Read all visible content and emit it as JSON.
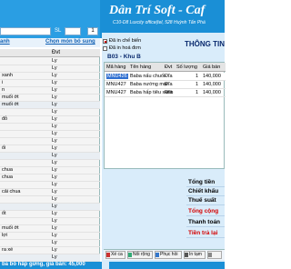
{
  "header": {
    "brand": "Dân Trí Soft - Caf",
    "subtitle": "C10-D8 Luxcity office(tel, 528 Huỳnh Tấn Phá",
    "address": ""
  },
  "order_search": {
    "sl_label": "SL",
    "quantity": "1",
    "search_value": ""
  },
  "links": {
    "left": "anh",
    "right": "Chọn món bổ sung"
  },
  "menu": {
    "col_name": "",
    "col_unit": "Đvt",
    "rows": [
      {
        "name": "",
        "unit": "Ly"
      },
      {
        "name": "",
        "unit": "Ly"
      },
      {
        "name": "xanh",
        "unit": "Ly"
      },
      {
        "name": "i",
        "unit": "Ly"
      },
      {
        "name": "n",
        "unit": "Ly"
      },
      {
        "name": "muối ớt",
        "unit": "Ly"
      },
      {
        "name": "muối ớt",
        "unit": "Ly"
      },
      {
        "name": "",
        "unit": "Ly"
      },
      {
        "name": "đỏ",
        "unit": "Ly"
      },
      {
        "name": "",
        "unit": "Ly"
      },
      {
        "name": "",
        "unit": "Ly"
      },
      {
        "name": "",
        "unit": "Ly"
      },
      {
        "name": "ối",
        "unit": "Ly"
      },
      {
        "name": "",
        "unit": "Ly"
      },
      {
        "name": "",
        "unit": "Ly"
      },
      {
        "name": "chua",
        "unit": "Ly"
      },
      {
        "name": "chua",
        "unit": "Ly"
      },
      {
        "name": "",
        "unit": "Ly"
      },
      {
        "name": "cải chua",
        "unit": "Ly"
      },
      {
        "name": "",
        "unit": "Ly"
      },
      {
        "name": "",
        "unit": "Ly"
      },
      {
        "name": "ốt",
        "unit": "Ly"
      },
      {
        "name": "",
        "unit": "Ly"
      },
      {
        "name": "muối ớt",
        "unit": "Ly"
      },
      {
        "name": "lợi",
        "unit": "Ly"
      },
      {
        "name": "",
        "unit": "Ly"
      },
      {
        "name": "ra xé",
        "unit": "Ly"
      },
      {
        "name": "",
        "unit": "Ly"
      }
    ]
  },
  "footer_left": "ba bò hấp gừng, giá bán: 45,000",
  "order": {
    "checkbox_cooked": "Đã in chế biến",
    "checkbox_invoice": "Đã in hoá đơn",
    "info_title": "THÔNG TIN",
    "table_name": "B03 - Khu B",
    "columns": [
      "Mã hàng",
      "Tên hàng",
      "Đvt",
      "Số lượng",
      "Giá bán"
    ],
    "rows": [
      {
        "code": "MNU426",
        "name": "Baba nấu chuối",
        "unit": "Đĩa",
        "qty": "1",
        "price": "140,000",
        "selected": true
      },
      {
        "code": "MNU427",
        "name": "Baba nướng mọi",
        "unit": "Đĩa",
        "qty": "1",
        "price": "140,000",
        "selected": false
      },
      {
        "code": "MNU427",
        "name": "Baba hấp tiêu xanh",
        "unit": "Đĩa",
        "qty": "1",
        "price": "140,000",
        "selected": false
      }
    ]
  },
  "totals": {
    "subtotal": "Tổng tiền",
    "discount": "Chiết khấu",
    "tax": "Thuế suất",
    "grand_total": "Tổng cộng",
    "paid": "Thanh toán",
    "change": "Tiền trả lại"
  },
  "toolbar": {
    "buttons": [
      "Xé ca",
      "Nối rộng",
      "Phục hồi",
      "In tạm",
      ""
    ]
  },
  "colors": {
    "banner": "#1a8fd6",
    "panel": "#d9ecfa",
    "accent_red": "#d40000",
    "selection": "#2f6fd0"
  }
}
